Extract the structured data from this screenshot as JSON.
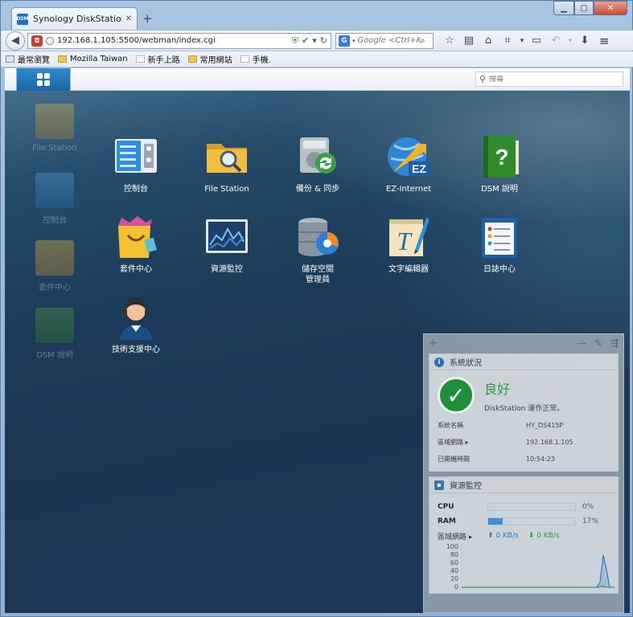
{
  "browser": {
    "tab_title": "Synology DiskStation - H...",
    "tab_favicon_text": "DSM",
    "new_tab_label": "+",
    "url": "192.168.1.105:5500/webman/index.cgi",
    "search_placeholder": "Google <Ctrl+K>",
    "search_engine": "G",
    "bookmarks": [
      "最常瀏覽",
      "Mozilla Taiwan",
      "新手上路",
      "常用網站",
      "手機."
    ]
  },
  "dsm": {
    "search_placeholder": "搜尋",
    "desktop_shortcuts": [
      "File Station",
      "控制台",
      "套件中心",
      "DSM 說明"
    ],
    "apps": [
      "控制台",
      "File Station",
      "備份 & 同步",
      "EZ-Internet",
      "DSM 說明",
      "套件中心",
      "資源監控",
      "儲存空間\n管理員",
      "文字編輯器",
      "日誌中心",
      "技術支援中心"
    ],
    "widget": {
      "system_status": {
        "title": "系統狀況",
        "status": "良好",
        "status_detail": "DiskStation 運作正常。",
        "server_name_label": "系統名稱",
        "server_name": "HY_DS415P",
        "lan_label": "區域網路 ▸",
        "lan_ip": "192.168.1.105",
        "uptime_label": "已開機時間",
        "uptime": "10:54:23"
      },
      "resource_monitor": {
        "title": "資源監控",
        "cpu_label": "CPU",
        "cpu_value": "0%",
        "cpu_fraction": 0.0,
        "ram_label": "RAM",
        "ram_value": "17%",
        "ram_fraction": 0.17,
        "lan_label": "區域網路 ▸",
        "upload": "0 KB/s",
        "download": "0 KB/s",
        "chart_ticks": [
          "100",
          "80",
          "60",
          "40",
          "20",
          "0"
        ]
      }
    }
  }
}
